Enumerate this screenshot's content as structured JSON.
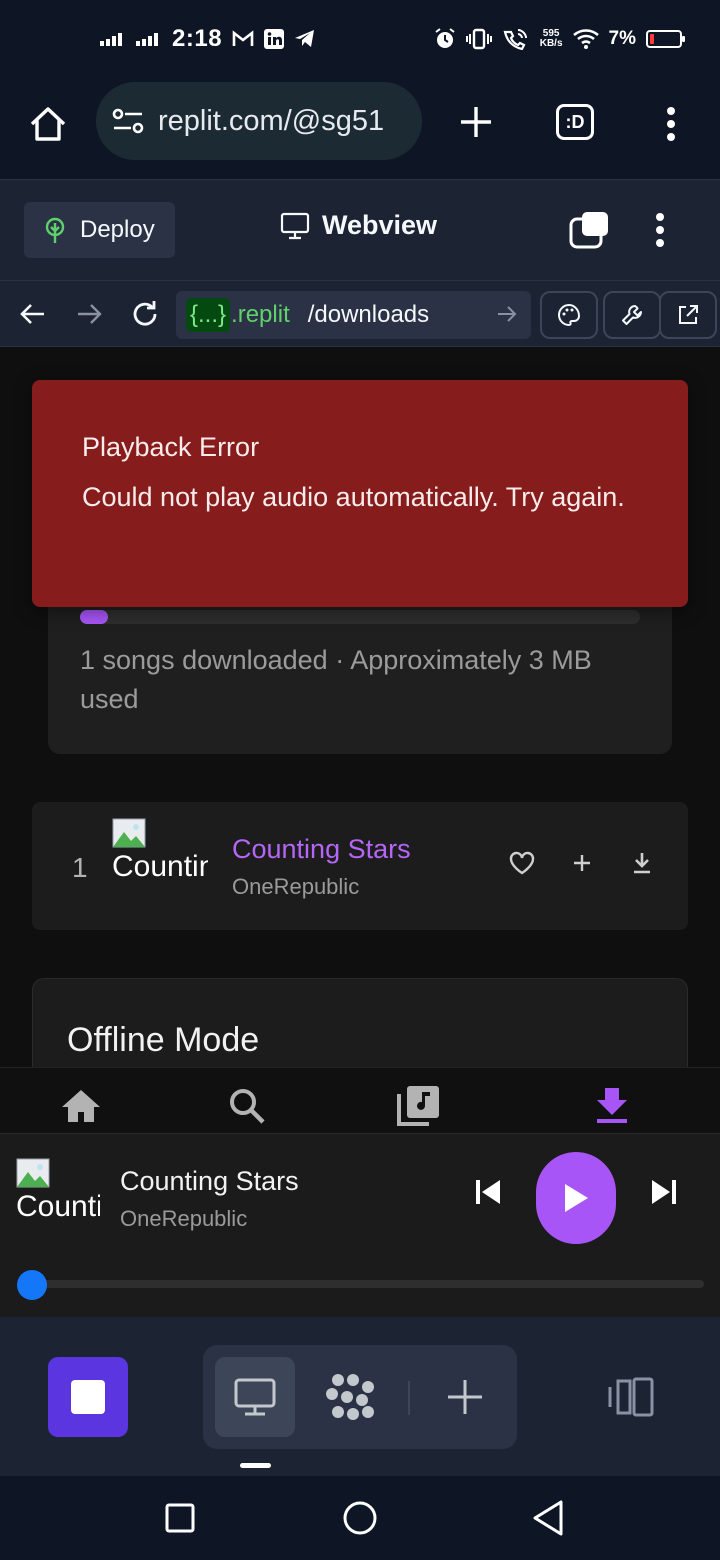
{
  "status_bar": {
    "time": "2:18",
    "net_speed_value": "595",
    "net_speed_unit": "KB/s",
    "battery_percent": "7%"
  },
  "browser": {
    "url": "replit.com/@sg51",
    "tabs_label": ":D"
  },
  "replit_header": {
    "deploy_label": "Deploy",
    "webview_label": "Webview"
  },
  "address_bar": {
    "badge": "{...}",
    "domain": ".replit",
    "path": "/downloads"
  },
  "error_toast": {
    "title": "Playback Error",
    "message": "Could not play audio automatically. Try again."
  },
  "storage": {
    "progress_percent": 5,
    "summary": "1 songs downloaded · Approximately 3 MB used"
  },
  "downloads": [
    {
      "number": "1",
      "thumb_alt": "Counting Stars",
      "title": "Counting Stars",
      "artist": "OneRepublic"
    }
  ],
  "offline_card": {
    "title": "Offline Mode"
  },
  "now_playing": {
    "thumb_alt": "Counting Stars",
    "title": "Counting Stars",
    "artist": "OneRepublic",
    "progress_fraction": 0
  },
  "colors": {
    "accent": "#a855f7",
    "error_bg": "#861c1c",
    "seek_knob": "#1477f8",
    "replit_stop": "#5b36e0"
  },
  "icons": {
    "bottom_tabs": [
      "home-icon",
      "search-icon",
      "library-icon",
      "download-icon"
    ],
    "row_actions": [
      "heart-icon",
      "add-icon",
      "download-icon"
    ]
  }
}
